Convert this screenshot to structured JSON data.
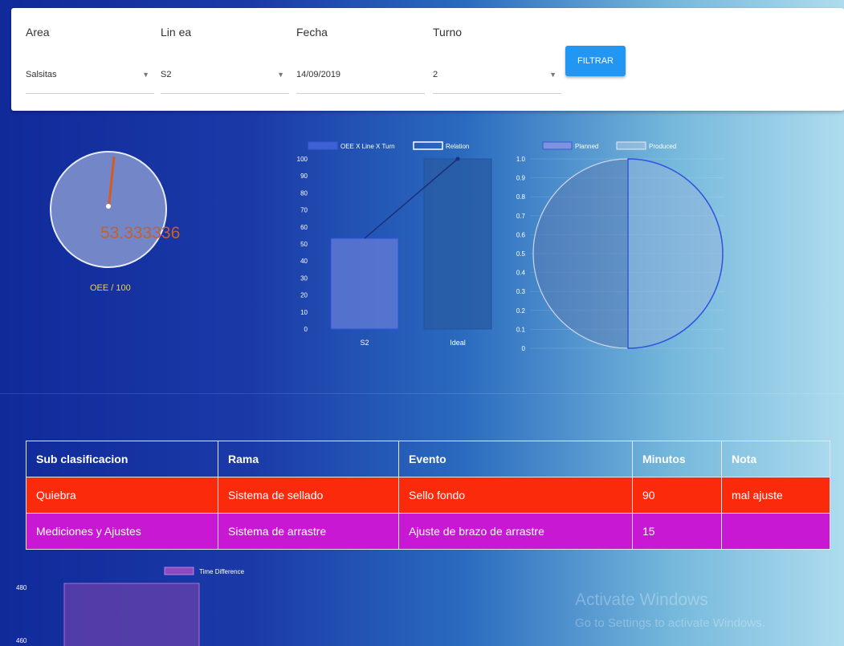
{
  "filters": {
    "area": {
      "label": "Area",
      "value": "Salsitas"
    },
    "linea": {
      "label": "Lin ea",
      "value": "S2"
    },
    "fecha": {
      "label": "Fecha",
      "value": "14/09/2019"
    },
    "turno": {
      "label": "Turno",
      "value": "2"
    },
    "button_label": "FILTRAR"
  },
  "gauge": {
    "value_text": "53.333336",
    "value": 53.333336,
    "label": "OEE / 100",
    "needle_color": "#d65b1e"
  },
  "chart_data": [
    {
      "type": "bar",
      "categories": [
        "S2",
        "Ideal"
      ],
      "series": [
        {
          "name": "OEE X Line X Turn",
          "values": [
            53.3,
            100
          ]
        },
        {
          "name": "Relation",
          "values": [
            53.3,
            100
          ]
        }
      ],
      "ylim": [
        0,
        100
      ],
      "yticks": [
        "100",
        "90",
        "80",
        "70",
        "60",
        "50",
        "40",
        "30",
        "20",
        "10",
        "0"
      ]
    },
    {
      "type": "pie",
      "labels": [
        "Planned",
        "Produced"
      ],
      "values": [
        1,
        1
      ],
      "yticks": [
        "1.0",
        "0.9",
        "0.8",
        "0.7",
        "0.6",
        "0.5",
        "0.4",
        "0.3",
        "0.2",
        "0.1",
        "0"
      ],
      "legend_text": [
        "Planned",
        "Produced"
      ]
    },
    {
      "type": "bar",
      "series": [
        {
          "name": "Time Difference",
          "values": [
            480
          ]
        }
      ],
      "yticks": [
        "480",
        "460"
      ]
    }
  ],
  "table": {
    "headers": [
      "Sub clasificacion",
      "Rama",
      "Evento",
      "Minutos",
      "Nota"
    ],
    "rows": [
      [
        "Quiebra",
        "Sistema de sellado",
        "Sello fondo",
        "90",
        "mal ajuste"
      ],
      [
        "Mediciones y Ajustes",
        "Sistema de arrastre",
        "Ajuste de brazo de arrastre",
        "15",
        ""
      ]
    ],
    "row_colors": [
      "#fb2a0b",
      "#c918d3"
    ]
  },
  "watermark": {
    "line1": "Activate Windows",
    "line2": "Go to Settings to activate Windows."
  }
}
